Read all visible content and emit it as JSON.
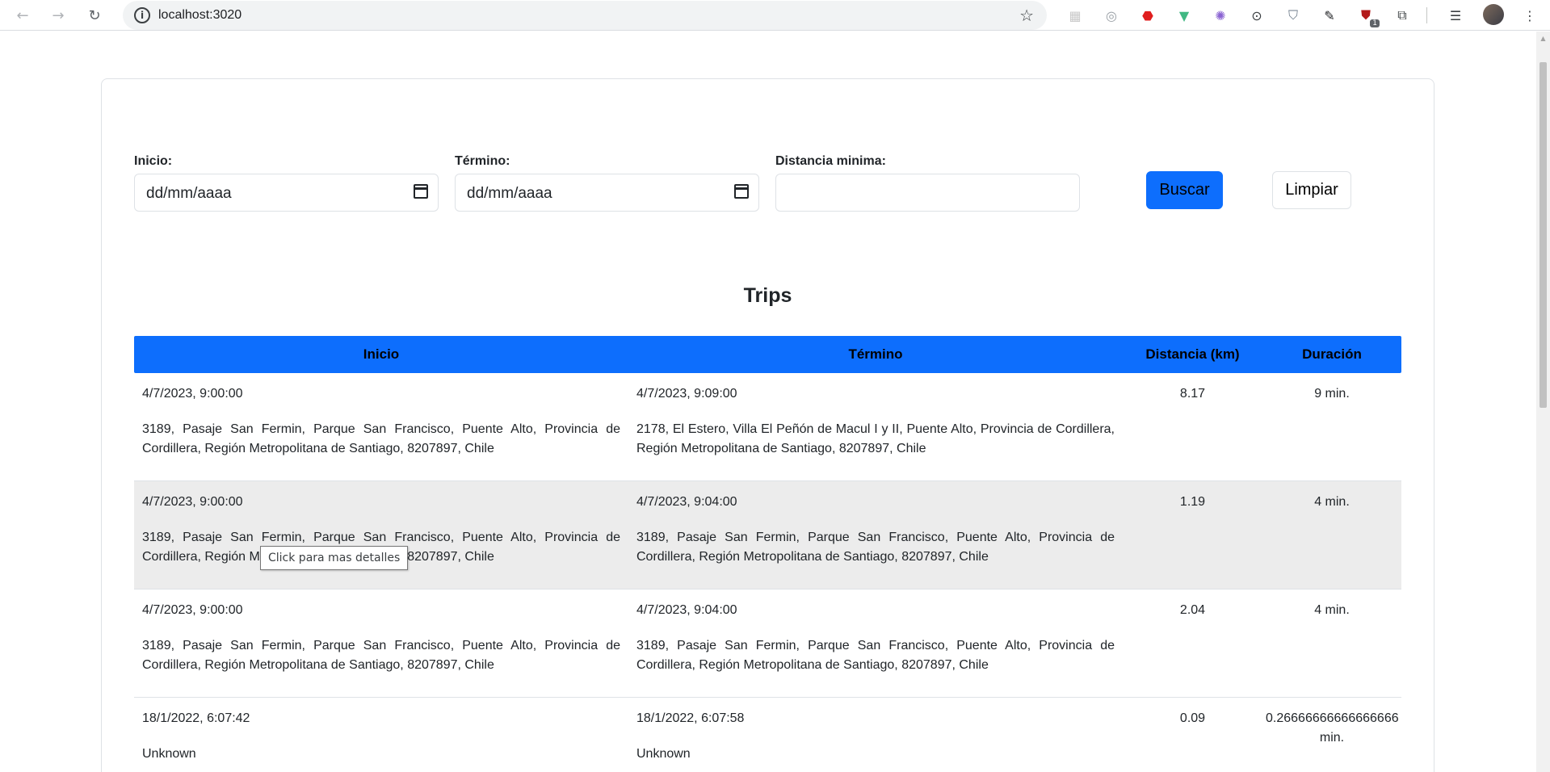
{
  "browser": {
    "url": "localhost:3020",
    "extension_badge": "1"
  },
  "filters": {
    "inicio_label": "Inicio:",
    "inicio_placeholder": "dd/mm/aaaa",
    "termino_label": "Término:",
    "termino_placeholder": "dd/mm/aaaa",
    "distancia_label": "Distancia minima:",
    "distancia_value": "",
    "buscar_label": "Buscar",
    "limpiar_label": "Limpiar"
  },
  "trips": {
    "title": "Trips",
    "headers": {
      "inicio": "Inicio",
      "termino": "Término",
      "distancia": "Distancia (km)",
      "duracion": "Duración"
    },
    "rows": [
      {
        "start_date": "4/7/2023, 9:00:00",
        "start_address": "3189, Pasaje San Fermin, Parque San Francisco, Puente Alto, Provincia de Cordillera, Región Metropolitana de Santiago, 8207897, Chile",
        "end_date": "4/7/2023, 9:09:00",
        "end_address": "2178, El Estero, Villa El Peñón de Macul I y II, Puente Alto, Provincia de Cordillera, Región Metropolitana de Santiago, 8207897, Chile",
        "distance": "8.17",
        "duration": "9 min."
      },
      {
        "start_date": "4/7/2023, 9:00:00",
        "start_address": "3189, Pasaje San Fermin, Parque San Francisco, Puente Alto, Provincia de Cordillera, Región Metropolitana de Santiago, 8207897, Chile",
        "end_date": "4/7/2023, 9:04:00",
        "end_address": "3189, Pasaje San Fermin, Parque San Francisco, Puente Alto, Provincia de Cordillera, Región Metropolitana de Santiago, 8207897, Chile",
        "distance": "1.19",
        "duration": "4 min."
      },
      {
        "start_date": "4/7/2023, 9:00:00",
        "start_address": "3189, Pasaje San Fermin, Parque San Francisco, Puente Alto, Provincia de Cordillera, Región Metropolitana de Santiago, 8207897, Chile",
        "end_date": "4/7/2023, 9:04:00",
        "end_address": "3189, Pasaje San Fermin, Parque San Francisco, Puente Alto, Provincia de Cordillera, Región Metropolitana de Santiago, 8207897, Chile",
        "distance": "2.04",
        "duration": "4 min."
      },
      {
        "start_date": "18/1/2022, 6:07:42",
        "start_address": "Unknown",
        "end_date": "18/1/2022, 6:07:58",
        "end_address": "Unknown",
        "distance": "0.09",
        "duration": "0.26666666666666666 min."
      }
    ]
  },
  "tooltip": {
    "text": "Click para mas detalles"
  },
  "colors": {
    "primary": "#0d6efd",
    "row_hover": "#ececec",
    "border": "#dee2e6"
  }
}
